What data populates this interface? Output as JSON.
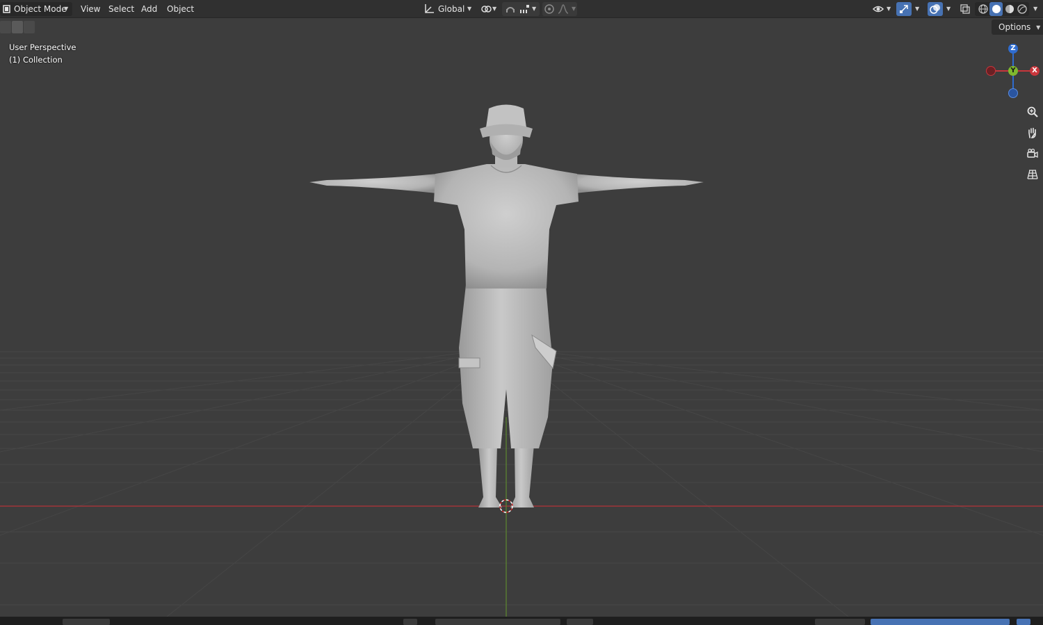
{
  "header": {
    "mode_label": "Object Mode",
    "menus": [
      "View",
      "Select",
      "Add",
      "Object"
    ],
    "orientation_label": "Global"
  },
  "toolbar": {
    "options_label": "Options"
  },
  "viewport": {
    "view_name": "User Perspective",
    "collection_label": "(1) Collection"
  },
  "gizmo": {
    "z_label": "Z",
    "y_label": "Y",
    "x_label": "X"
  },
  "nav_icons": [
    "zoom-icon",
    "pan-hand-icon",
    "camera-icon",
    "grid-ortho-icon"
  ],
  "colors": {
    "background": "#3d3d3d",
    "header": "#303030",
    "x_axis": "#c8363c",
    "y_axis": "#5d8a2e",
    "z_axis": "#2f6ccf",
    "active_blue": "#4772b3"
  }
}
